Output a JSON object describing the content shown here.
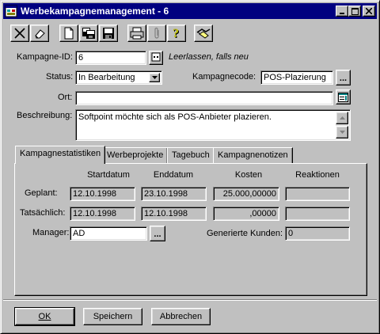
{
  "window": {
    "title": "Werbekampagnemanagement - 6"
  },
  "toolbar": {
    "icons": [
      "delete-icon",
      "eraser-icon",
      "new-document-icon",
      "copy-icon",
      "save-icon",
      "print-icon",
      "attach-icon",
      "help-icon",
      "handshake-icon"
    ]
  },
  "form": {
    "kampagne_id": {
      "label": "Kampagne-ID:",
      "value": "6",
      "hint": "Leerlassen, falls neu"
    },
    "status": {
      "label": "Status:",
      "value": "In Bearbeitung"
    },
    "kampagnecode": {
      "label": "Kampagnecode:",
      "value": "POS-Plazierung",
      "button": "..."
    },
    "ort": {
      "label": "Ort:",
      "value": ""
    },
    "beschreibung": {
      "label": "Beschreibung:",
      "value": "Softpoint möchte sich als POS-Anbieter plazieren."
    }
  },
  "tabs": [
    {
      "label": "Kampagnestatistiken",
      "active": true
    },
    {
      "label": "Werbeprojekte",
      "active": false
    },
    {
      "label": "Tagebuch",
      "active": false
    },
    {
      "label": "Kampagnenotizen",
      "active": false
    }
  ],
  "stats": {
    "headers": [
      "Startdatum",
      "Enddatum",
      "Kosten",
      "Reaktionen"
    ],
    "geplant": {
      "label": "Geplant:",
      "startdatum": "12.10.1998",
      "enddatum": "23.10.1998",
      "kosten": "25.000,00000",
      "reaktionen": ""
    },
    "tatsaechlich": {
      "label": "Tatsächlich:",
      "startdatum": "12.10.1998",
      "enddatum": "12.10.1998",
      "kosten": ",00000",
      "reaktionen": ""
    },
    "manager": {
      "label": "Manager:",
      "value": "AD",
      "button": "..."
    },
    "generierte_kunden": {
      "label": "Generierte Kunden:",
      "value": "0"
    }
  },
  "buttons": {
    "ok": "OK",
    "speichern": "Speichern",
    "abbrechen": "Abbrechen"
  },
  "colors": {
    "titlebar": "#000080",
    "face": "#c0c0c0"
  }
}
